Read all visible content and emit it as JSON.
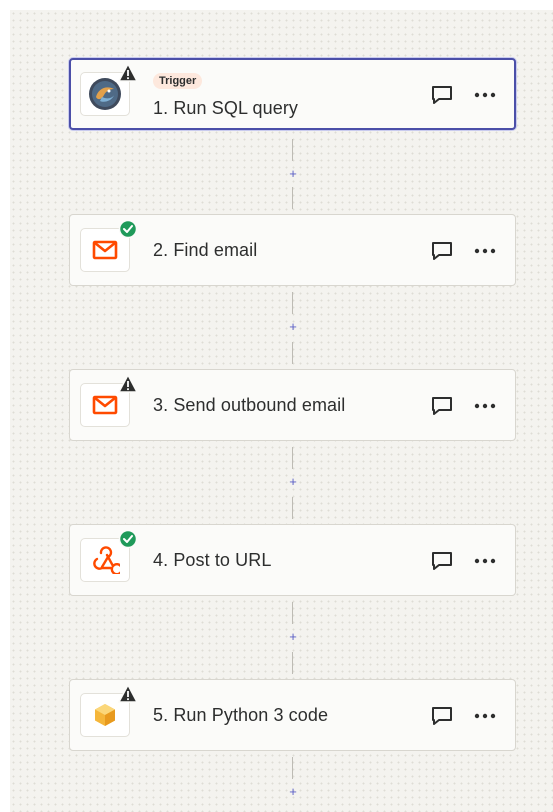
{
  "steps": [
    {
      "number": "1.",
      "title": "1. Run SQL query",
      "tag": "Trigger",
      "app_icon": "mysql-icon",
      "status": "warning"
    },
    {
      "number": "2.",
      "title": "2. Find email",
      "app_icon": "email-icon",
      "status": "success"
    },
    {
      "number": "3.",
      "title": "3. Send outbound email",
      "app_icon": "email-icon",
      "status": "warning"
    },
    {
      "number": "4.",
      "title": "4. Post to URL",
      "app_icon": "webhook-icon",
      "status": "success"
    },
    {
      "number": "5.",
      "title": "5. Run Python 3 code",
      "app_icon": "code-icon",
      "status": "warning"
    }
  ],
  "add_step_symbol": "+",
  "colors": {
    "accent": "#4b4fa8",
    "warning": "#2d2e2e",
    "success": "#1f9a5a",
    "email": "#ff4a00",
    "plus": "#5b5fc7"
  }
}
